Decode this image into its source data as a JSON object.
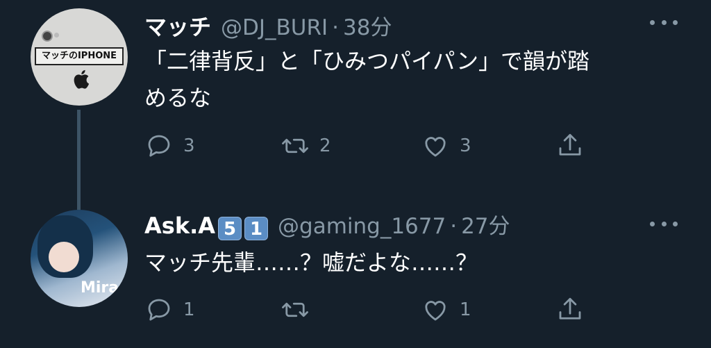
{
  "tweets": [
    {
      "name": "マッチ",
      "badges": [],
      "handle": "@DJ_BURI",
      "separator": "·",
      "time": "38分",
      "text_line1": "「二律背反」と「ひみつパイパン」で韻が踏",
      "text_line2": "めるな",
      "avatar_label": "マッチのIPHONE",
      "avatar_icon": "apple-logo-icon",
      "actions": {
        "reply_count": "3",
        "retweet_count": "2",
        "like_count": "3"
      }
    },
    {
      "name": "Ask.A",
      "badges": [
        "5",
        "1"
      ],
      "handle": "@gaming_1677",
      "separator": "·",
      "time": "27分",
      "text_line1": "マッチ先輩……？嘘だよな……？",
      "avatar_label": "Mira",
      "actions": {
        "reply_count": "1",
        "retweet_count": "",
        "like_count": "1"
      }
    }
  ],
  "icons": [
    "reply-icon",
    "retweet-icon",
    "like-icon",
    "share-icon",
    "more-icon"
  ],
  "colors": {
    "background": "#15202b",
    "secondary_text": "#8899a6",
    "thread_line": "#3d5466"
  }
}
